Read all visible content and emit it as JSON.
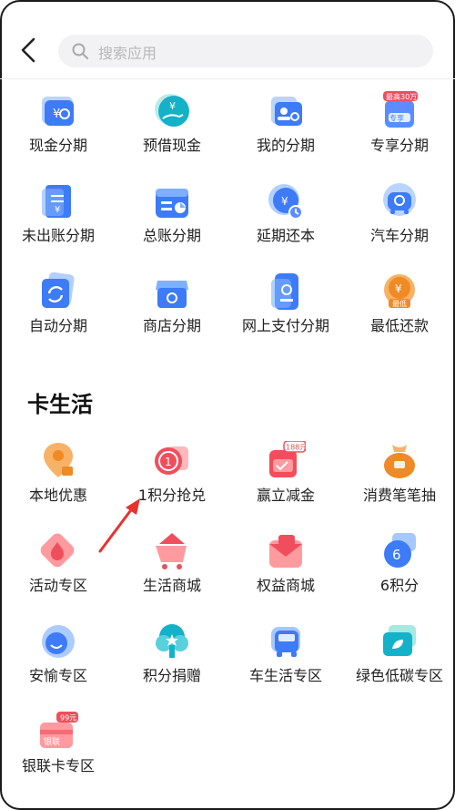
{
  "header": {
    "search_placeholder": "搜索应用"
  },
  "installment_apps": [
    {
      "label": "现金分期",
      "icon": "cash-installment-icon"
    },
    {
      "label": "预借现金",
      "icon": "cash-advance-icon"
    },
    {
      "label": "我的分期",
      "icon": "my-installment-icon"
    },
    {
      "label": "专享分期",
      "icon": "exclusive-installment-icon",
      "badge": "最高30万",
      "tag": "专享"
    },
    {
      "label": "未出账分期",
      "icon": "unbilled-installment-icon"
    },
    {
      "label": "总账分期",
      "icon": "total-bill-installment-icon"
    },
    {
      "label": "延期还本",
      "icon": "deferred-repayment-icon"
    },
    {
      "label": "汽车分期",
      "icon": "car-installment-icon"
    },
    {
      "label": "自动分期",
      "icon": "auto-installment-icon"
    },
    {
      "label": "商店分期",
      "icon": "store-installment-icon"
    },
    {
      "label": "网上支付分期",
      "icon": "online-payment-installment-icon"
    },
    {
      "label": "最低还款",
      "icon": "minimum-payment-icon",
      "tag": "最低"
    }
  ],
  "card_life": {
    "title": "卡生活",
    "apps": [
      {
        "label": "本地优惠",
        "icon": "local-deals-icon"
      },
      {
        "label": "1积分抢兑",
        "icon": "points-redeem-icon"
      },
      {
        "label": "赢立减金",
        "icon": "discount-coupon-icon",
        "badge": "188元"
      },
      {
        "label": "消费笔笔抽",
        "icon": "spend-lottery-icon"
      },
      {
        "label": "活动专区",
        "icon": "events-zone-icon"
      },
      {
        "label": "生活商城",
        "icon": "life-mall-icon"
      },
      {
        "label": "权益商城",
        "icon": "benefits-mall-icon"
      },
      {
        "label": "6积分",
        "icon": "six-points-icon"
      },
      {
        "label": "安愉专区",
        "icon": "anyu-zone-icon"
      },
      {
        "label": "积分捐赠",
        "icon": "points-donation-icon"
      },
      {
        "label": "车生活专区",
        "icon": "car-life-zone-icon"
      },
      {
        "label": "绿色低碳专区",
        "icon": "green-low-carbon-icon"
      },
      {
        "label": "银联卡专区",
        "icon": "unionpay-card-zone-icon",
        "badge": "99元",
        "tag": "银联"
      }
    ]
  },
  "colors": {
    "blue": "#3d7bf7",
    "teal": "#14b2c8",
    "orange": "#f08a24",
    "red": "#f04e5c"
  }
}
